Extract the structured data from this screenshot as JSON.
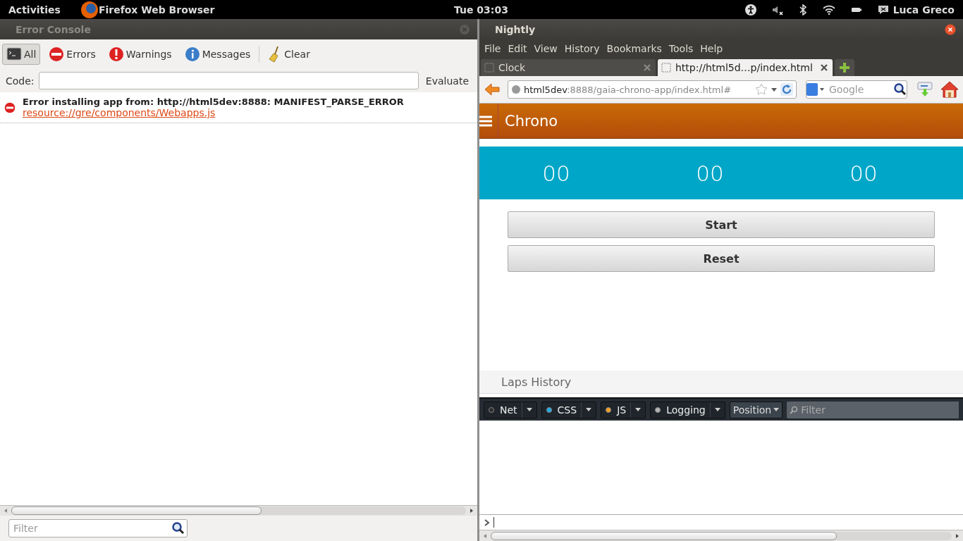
{
  "top_bar": {
    "activities": "Activities",
    "app": "Firefox Web Browser",
    "clock": "Tue 03:03",
    "user": "Luca Greco"
  },
  "error_console": {
    "title": "Error Console",
    "filters": [
      {
        "kind": "all",
        "label": "All",
        "selected": true
      },
      {
        "kind": "error",
        "label": "Errors",
        "selected": false
      },
      {
        "kind": "warning",
        "label": "Warnings",
        "selected": false
      },
      {
        "kind": "message",
        "label": "Messages",
        "selected": false
      }
    ],
    "clear": "Clear",
    "code_label": "Code:",
    "evaluate": "Evaluate",
    "messages": [
      {
        "kind": "error",
        "text": "Error installing app from: http://html5dev:8888: MANIFEST_PARSE_ERROR",
        "source": "resource://gre/components/Webapps.js"
      }
    ],
    "filter_placeholder": "Filter"
  },
  "browser": {
    "title": "Nightly",
    "menu": [
      "File",
      "Edit",
      "View",
      "History",
      "Bookmarks",
      "Tools",
      "Help"
    ],
    "tabs": [
      {
        "label": "Clock",
        "selected": false
      },
      {
        "label": "http://html5d…p/index.html",
        "selected": true
      }
    ],
    "url": {
      "host": "html5dev",
      "rest": ":8888/gaia-chrono-app/index.html#"
    },
    "search_placeholder": "Google",
    "page": {
      "title": "Chrono",
      "timer": [
        "00",
        "00",
        "00"
      ],
      "buttons": [
        "Start",
        "Reset"
      ],
      "laps_title": "Laps History"
    },
    "devtools": {
      "filters": [
        {
          "label": "Net",
          "color": "#2b2b2b"
        },
        {
          "label": "CSS",
          "color": "#1eaee6"
        },
        {
          "label": "JS",
          "color": "#f5a020"
        },
        {
          "label": "Logging",
          "color": "#b4b4b4"
        }
      ],
      "position": "Position",
      "filter_placeholder": "Filter"
    }
  }
}
